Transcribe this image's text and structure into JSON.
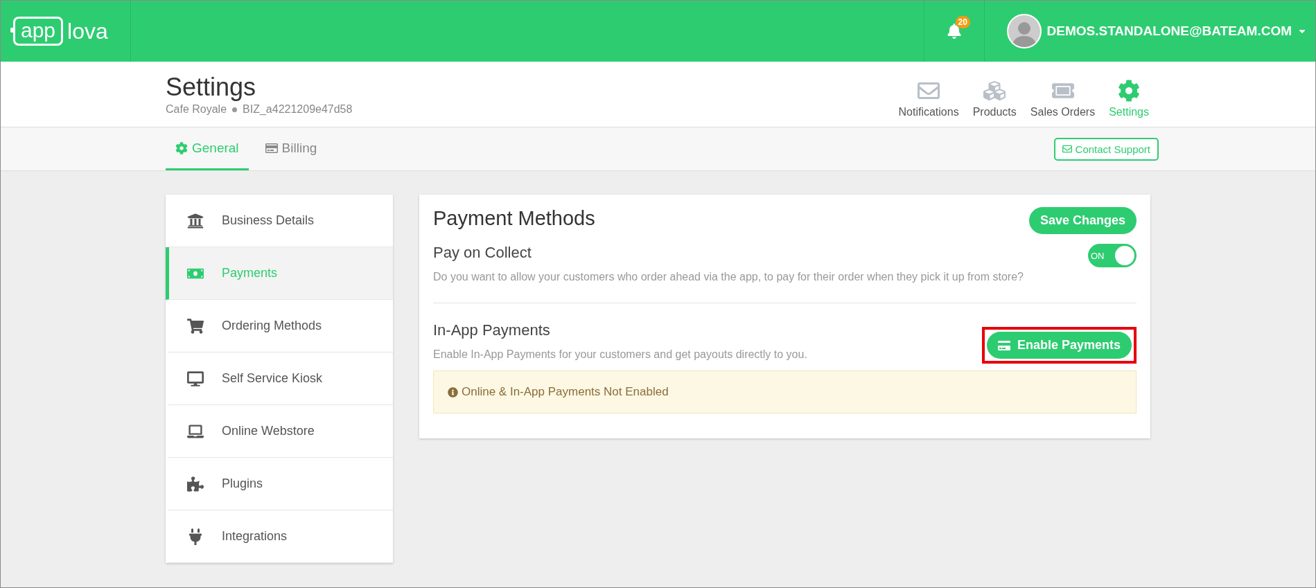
{
  "topbar": {
    "logo": {
      "boxed": "app",
      "plain": "lova"
    },
    "notifications_badge": "20",
    "user": "DEMOS.STANDALONE@BATEAM.COM"
  },
  "header": {
    "title": "Settings",
    "business": "Cafe Royale",
    "business_id": "BIZ_a4221209e47d58",
    "nav": [
      {
        "label": "Notifications",
        "selected": false
      },
      {
        "label": "Products",
        "selected": false
      },
      {
        "label": "Sales Orders",
        "selected": false
      },
      {
        "label": "Settings",
        "selected": true
      }
    ]
  },
  "tabs": [
    {
      "label": "General",
      "selected": true
    },
    {
      "label": "Billing",
      "selected": false
    }
  ],
  "contact_support": "Contact Support",
  "sidebar": {
    "items": [
      {
        "label": "Business Details",
        "selected": false
      },
      {
        "label": "Payments",
        "selected": true
      },
      {
        "label": "Ordering Methods",
        "selected": false
      },
      {
        "label": "Self Service Kiosk",
        "selected": false
      },
      {
        "label": "Online Webstore",
        "selected": false
      },
      {
        "label": "Plugins",
        "selected": false
      },
      {
        "label": "Integrations",
        "selected": false
      }
    ]
  },
  "panel": {
    "title": "Payment Methods",
    "save_button": "Save Changes",
    "pay_on_collect": {
      "title": "Pay on Collect",
      "description": "Do you want to allow your customers who order ahead via the app, to pay for their order when they pick it up from store?",
      "toggle": {
        "on": true,
        "label": "ON"
      }
    },
    "in_app": {
      "title": "In-App Payments",
      "description": "Enable In-App Payments for your customers and get payouts directly to you.",
      "button": {
        "label": "Enable Payments",
        "highlighted": true
      }
    },
    "alert": "Online & In-App Payments Not Enabled"
  }
}
